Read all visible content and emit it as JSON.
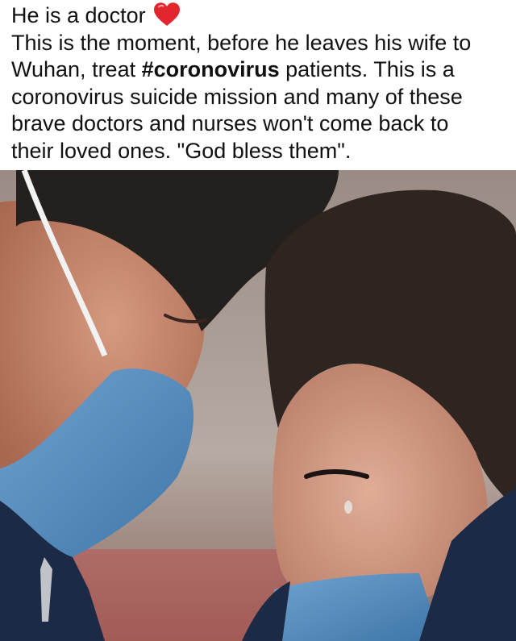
{
  "post": {
    "caption": {
      "first_line": "He is a doctor",
      "first_line_icon": "red-heart-icon",
      "line2": "This is the moment, before he leaves his wife to",
      "line3_prefix": "Wuhan, treat ",
      "hashtag": "#coronovirus",
      "line3_suffix": " patients. This is a",
      "line4": "coronovirus suicide mission and many of these",
      "line5": "brave doctors and nurses won't come back to",
      "line6": "their loved ones. \"God bless them\"."
    },
    "photo": {
      "subject": "doctor-and-wife-foreheads-touching",
      "mask_color": "#4f86b8",
      "jacket_color": "#1d2a45"
    },
    "colors": {
      "heart": "#e2262e",
      "text": "#111111",
      "background": "#ffffff"
    }
  }
}
